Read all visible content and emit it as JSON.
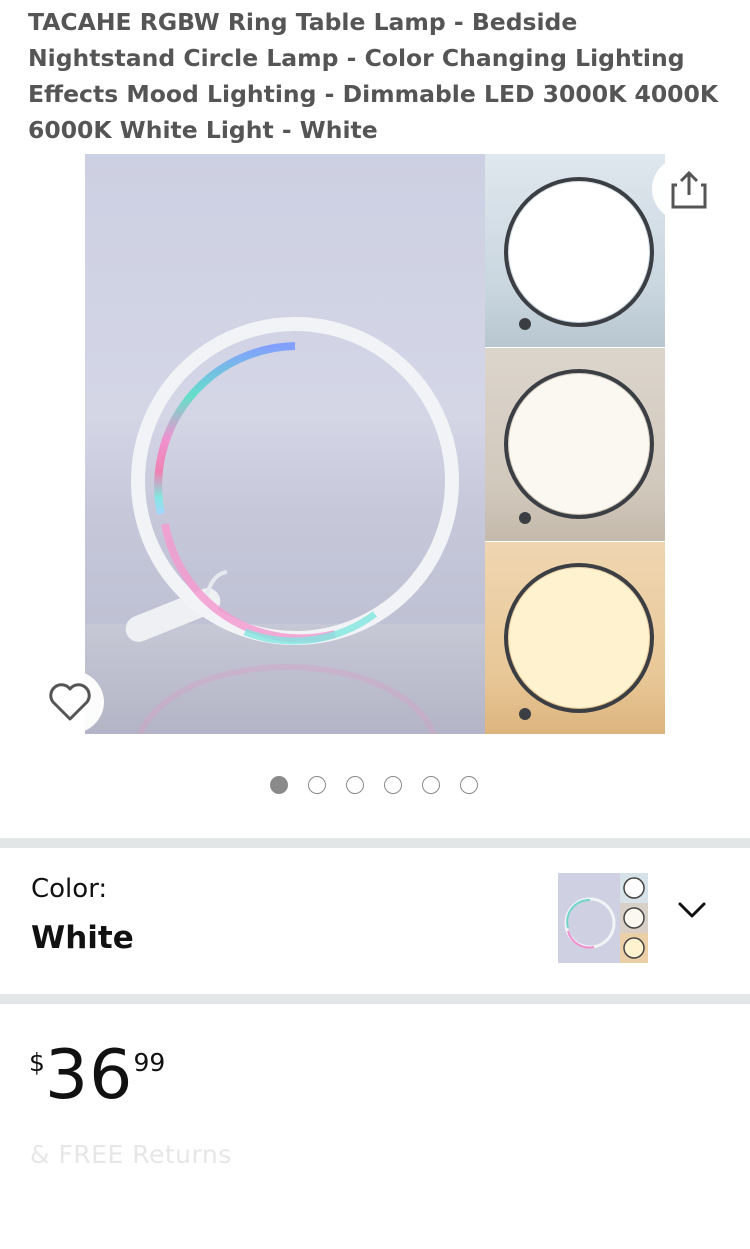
{
  "product": {
    "title": "TACAHE RGBW Ring Table Lamp - Bedside Nightstand Circle Lamp - Color Changing Lighting Effects Mood Lighting - Dimmable LED 3000K 4000K 6000K White Light - White"
  },
  "gallery": {
    "image_count": 6,
    "active_index": 0,
    "icons": {
      "share": "share-icon",
      "wishlist": "heart-icon"
    }
  },
  "variant": {
    "label": "Color:",
    "value": "White",
    "icon": "chevron-down-icon"
  },
  "price": {
    "symbol": "$",
    "whole": "36",
    "fraction": "99"
  },
  "partial_text": "& FREE Returns",
  "colors": {
    "divider": "#e3e6e6",
    "dot": "#8a8a8a"
  }
}
